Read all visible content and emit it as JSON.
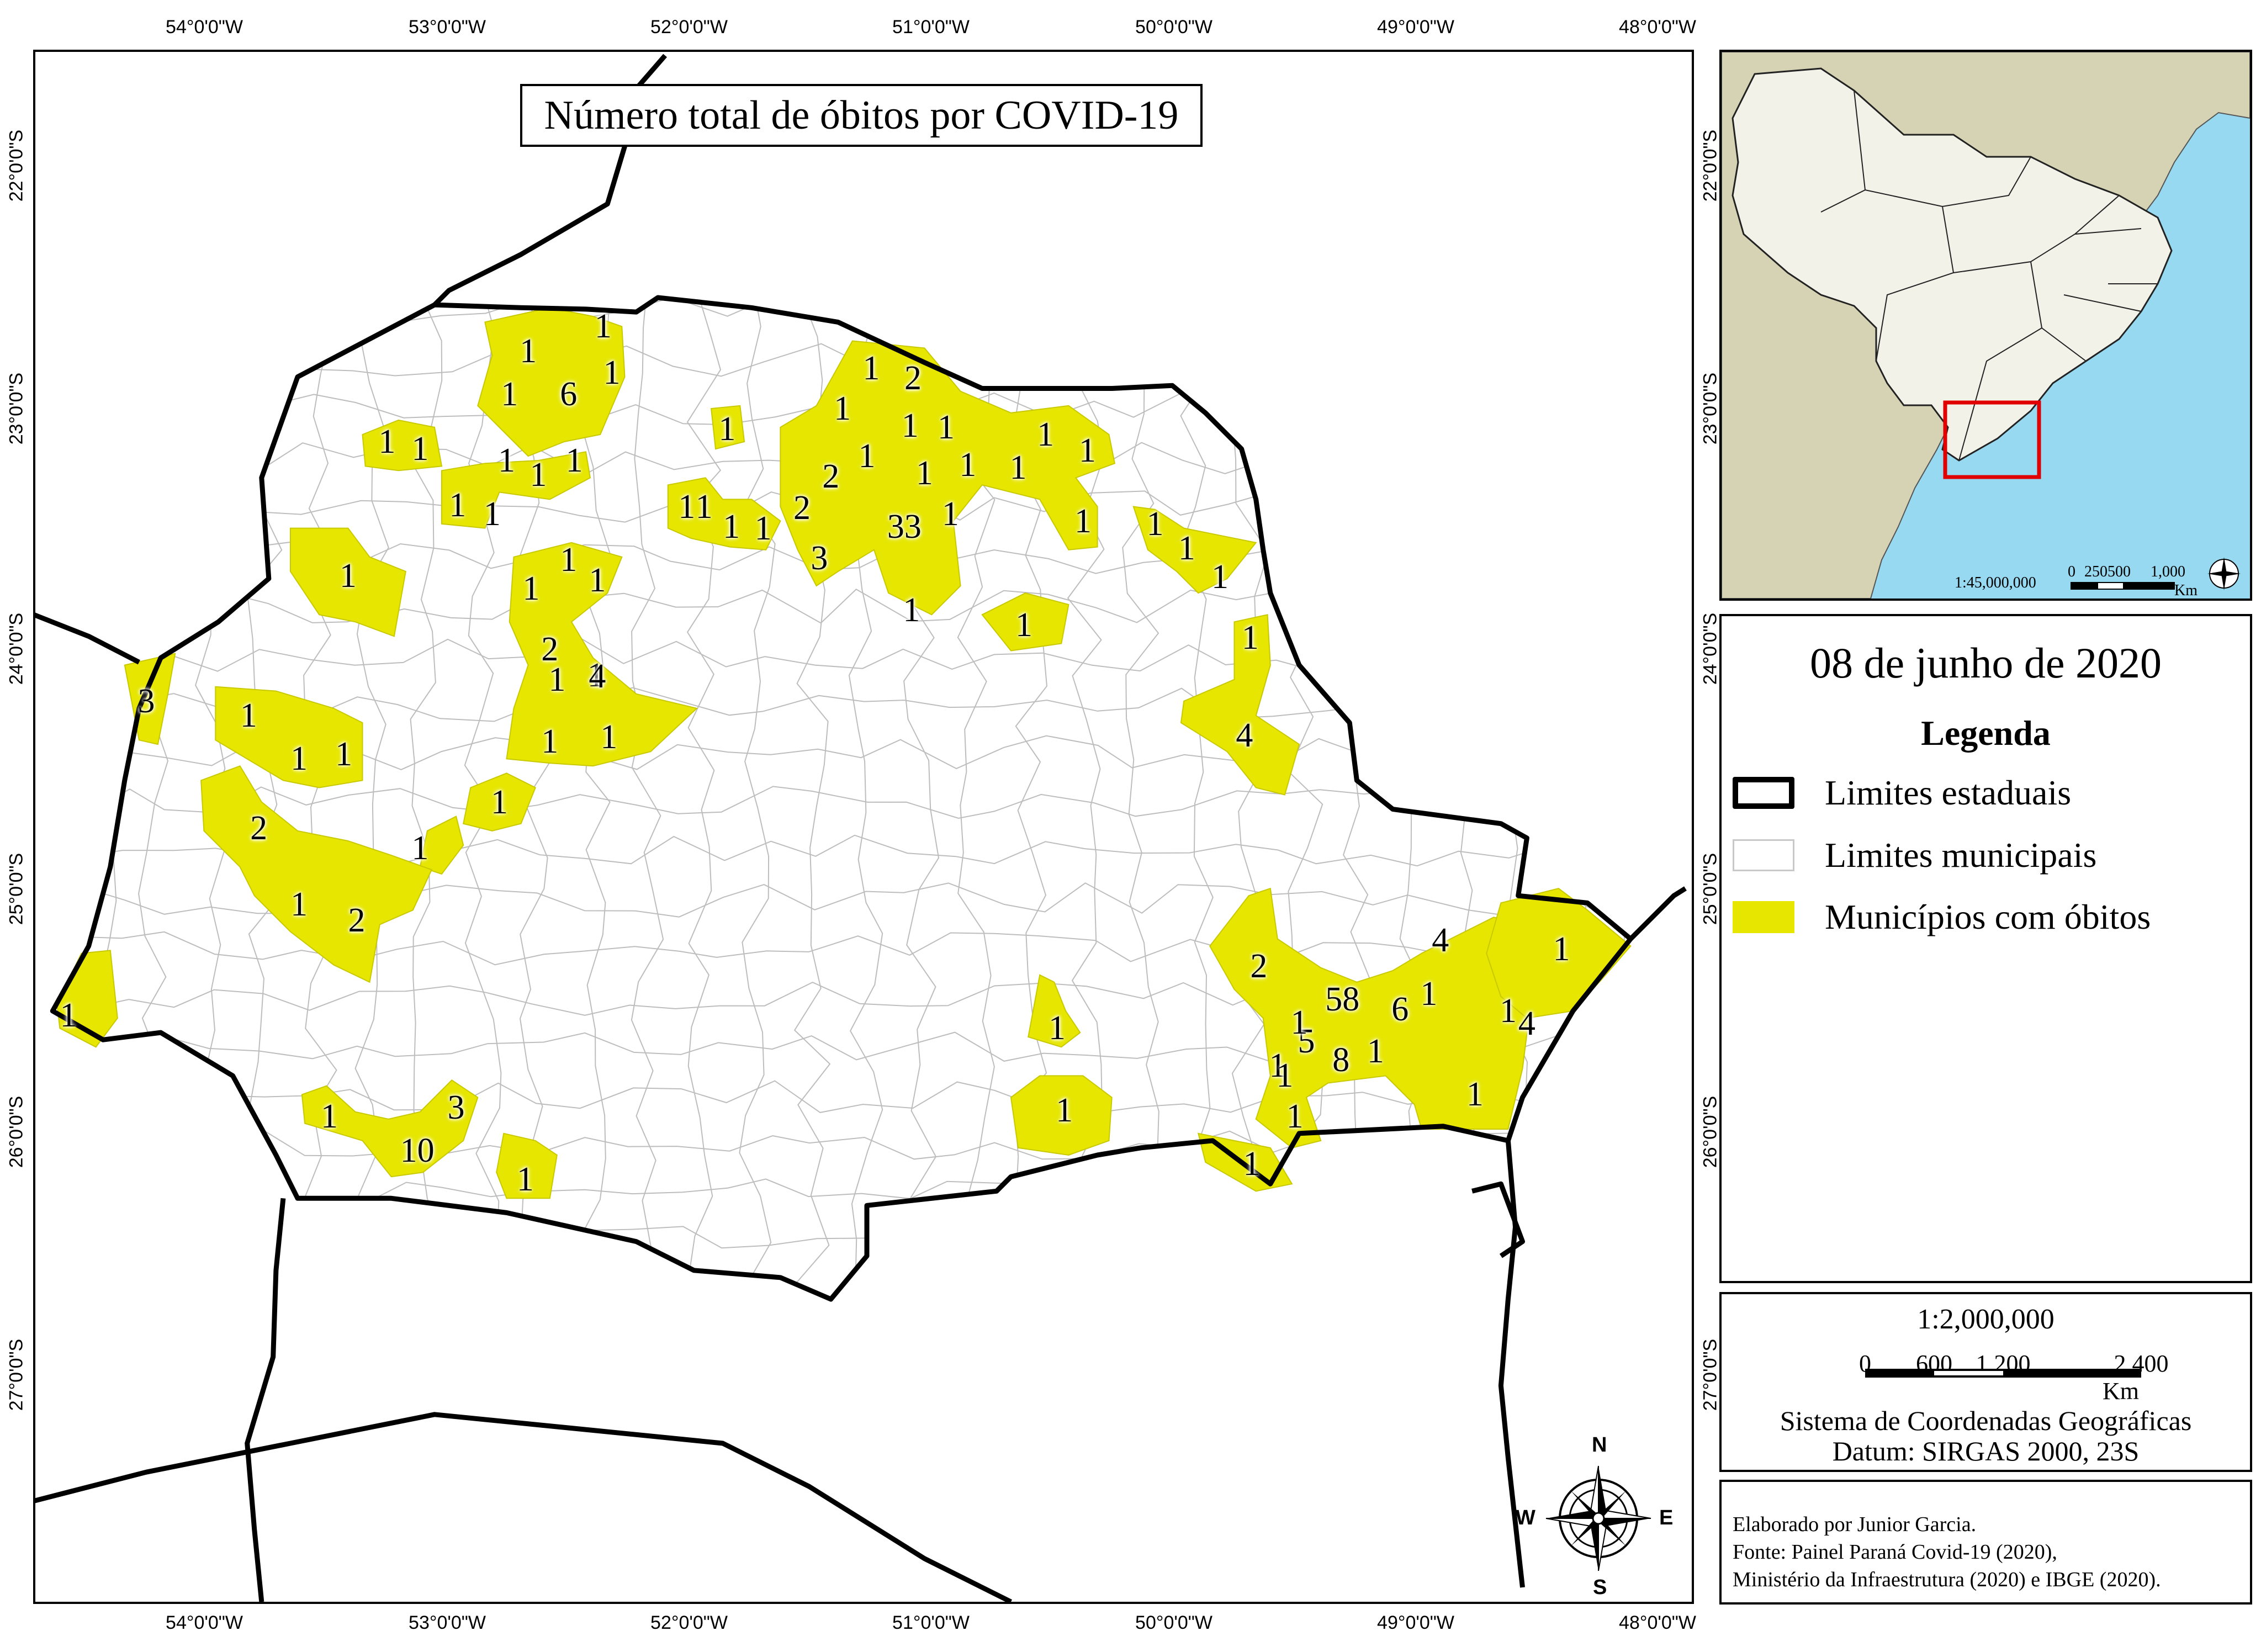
{
  "graticule": {
    "top_labels": [
      "54°0'0\"W",
      "53°0'0\"W",
      "52°0'0\"W",
      "51°0'0\"W",
      "50°0'0\"W",
      "49°0'0\"W",
      "48°0'0\"W"
    ],
    "bottom_labels": [
      "54°0'0\"W",
      "53°0'0\"W",
      "52°0'0\"W",
      "51°0'0\"W",
      "50°0'0\"W",
      "49°0'0\"W",
      "48°0'0\"W"
    ],
    "left_labels": [
      "22°0'0\"S",
      "23°0'0\"S",
      "24°0'0\"S",
      "25°0'0\"S",
      "26°0'0\"S",
      "27°0'0\"S"
    ],
    "right_labels": [
      "22°0'0\"S",
      "23°0'0\"S",
      "24°0'0\"S",
      "25°0'0\"S",
      "26°0'0\"S",
      "27°0'0\"S"
    ]
  },
  "map": {
    "title": "Número total de óbitos por COVID-19",
    "colors": {
      "state_boundary": "#000000",
      "municipal_boundary": "#bdbdbd",
      "municipality_with_deaths": "#e6e600",
      "background": "#ffffff"
    },
    "death_counts": [
      "1",
      "1",
      "6",
      "1",
      "1",
      "1",
      "1",
      "1",
      "1",
      "1",
      "1",
      "1",
      "1",
      "1",
      "1",
      "1",
      "2",
      "1",
      "1",
      "1",
      "2",
      "1",
      "1",
      "1",
      "2",
      "1",
      "1",
      "1",
      "1",
      "1",
      "1",
      "1",
      "1",
      "1",
      "2",
      "33",
      "1",
      "3",
      "1",
      "1",
      "1",
      "1",
      "1",
      "4",
      "1",
      "1",
      "1",
      "1",
      "1",
      "1",
      "4",
      "1",
      "1",
      "1",
      "1",
      "3",
      "1",
      "2",
      "1",
      "2",
      "1",
      "1",
      "1",
      "10",
      "3",
      "1",
      "1",
      "2",
      "1",
      "1",
      "4",
      "58",
      "6",
      "1",
      "1",
      "1",
      "5",
      "8",
      "1",
      "4",
      "1",
      "1",
      "1",
      "1"
    ]
  },
  "compass": {
    "north": "N",
    "south": "S",
    "east": "E",
    "west": "W"
  },
  "inset": {
    "scale_ratio": "1:45,000,000",
    "scale_labels": [
      "0",
      "250500",
      "1,000"
    ],
    "scale_unit": "Km",
    "colors": {
      "ocean": "#97d9f0",
      "south_america": "#d5d3b4",
      "brazil": "#f3f2e8",
      "highlight": "#e00000"
    }
  },
  "legend": {
    "date": "08 de junho de 2020",
    "title": "Legenda",
    "items": [
      {
        "label": "Limites estaduais",
        "swatch": "state-boundary"
      },
      {
        "label": "Limites municipais",
        "swatch": "municipal-boundary"
      },
      {
        "label": "Municípios com óbitos",
        "swatch": "municipality-with-deaths"
      }
    ]
  },
  "scale": {
    "ratio": "1:2,000,000",
    "labels": [
      "0",
      "600",
      "1,200",
      "2,400"
    ],
    "unit": "Km",
    "coordinate_system": "Sistema de Coordenadas Geográficas",
    "datum": "Datum: SIRGAS 2000, 23S"
  },
  "credits": {
    "author": "Elaborado por Junior Garcia.",
    "source_1": "Fonte: Painel Paraná Covid-19 (2020),",
    "source_2": "Ministério da Infraestrutura (2020) e IBGE (2020)."
  }
}
